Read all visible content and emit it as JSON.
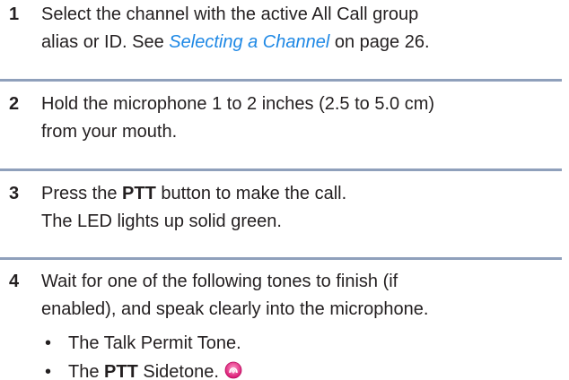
{
  "steps": [
    {
      "number": "1",
      "line1": "Select the channel with the active All Call group",
      "line2_pre": "alias or ID. See ",
      "line2_link": "Selecting a Channel",
      "line2_post": " on page 26."
    },
    {
      "number": "2",
      "line1": "Hold the microphone 1 to 2 inches (2.5 to 5.0 cm)",
      "line2": "from your mouth."
    },
    {
      "number": "3",
      "line1_pre": "Press the ",
      "line1_bold": "PTT",
      "line1_post": " button to make the call.",
      "line2": "The LED lights up solid green."
    },
    {
      "number": "4",
      "line1": "Wait for one of the following tones to finish (if",
      "line2": "enabled), and speak clearly into the microphone.",
      "bullets": [
        {
          "text": "The Talk Permit Tone."
        },
        {
          "pre": "The ",
          "bold": "PTT",
          "post": " Sidetone."
        }
      ]
    }
  ],
  "colors": {
    "divider": "#8fa0bb",
    "link": "#1e88e5",
    "icon": "#e0177a"
  },
  "icons": {
    "tone": "tone-sound-icon"
  }
}
